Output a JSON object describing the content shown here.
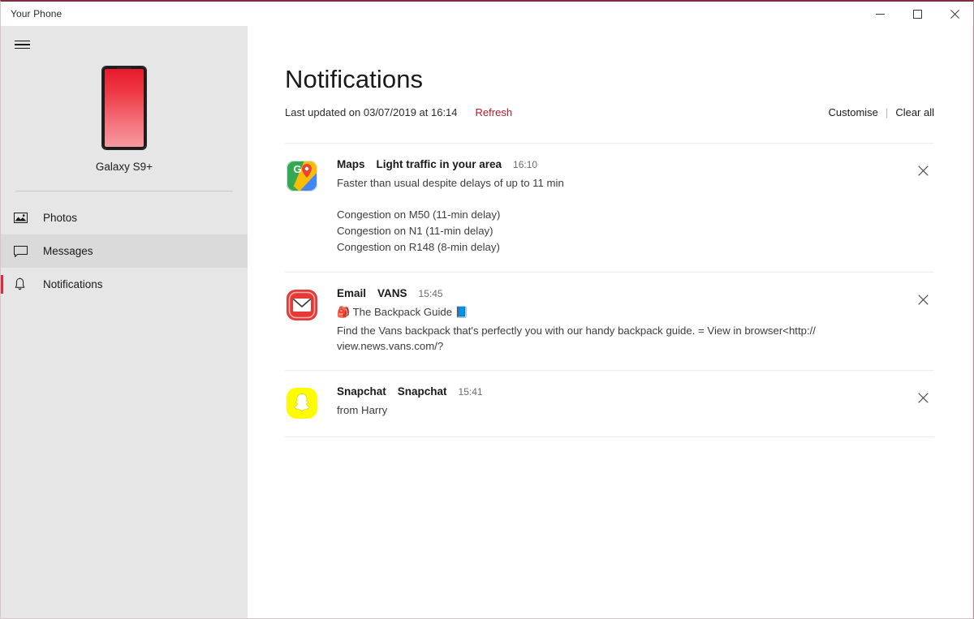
{
  "window": {
    "title": "Your Phone",
    "controls": [
      {
        "name": "minimize",
        "glyph": "minimize-icon"
      },
      {
        "name": "maximize",
        "glyph": "maximize-icon"
      },
      {
        "name": "close",
        "glyph": "close-icon"
      }
    ]
  },
  "sidebar": {
    "menu_icon": "hamburger-icon",
    "device_name": "Galaxy S9+",
    "device_image": "phone-illustration",
    "items": [
      {
        "label": "Photos",
        "icon": "photos-icon",
        "state": "normal"
      },
      {
        "label": "Messages",
        "icon": "messages-icon",
        "state": "hovered"
      },
      {
        "label": "Notifications",
        "icon": "bell-icon",
        "state": "selected"
      }
    ]
  },
  "main": {
    "page_title": "Notifications",
    "last_updated": "Last updated on 03/07/2019 at 16:14",
    "refresh_label": "Refresh",
    "customise_label": "Customise",
    "separator": "|",
    "clear_all_label": "Clear all",
    "close_glyph": "×",
    "notifications": [
      {
        "icon": "google-maps-icon",
        "app": "Maps",
        "title": "Light traffic in your area",
        "time": "16:10",
        "line": "Faster than usual despite delays of up to 11 min",
        "extra": [
          "Congestion on M50 (11-min delay)",
          "Congestion on N1 (11-min delay)",
          "Congestion on R148 (8-min delay)"
        ]
      },
      {
        "icon": "email-icon",
        "app": "Email",
        "title": "VANS",
        "time": "15:45",
        "line_prefix_emoji": "🎒",
        "line": "The Backpack Guide",
        "line_suffix_emoji": "📘",
        "extra": [
          "Find the Vans backpack that's perfectly you with our handy backpack guide. = View in browser<http:// view.news.vans.com/?"
        ]
      },
      {
        "icon": "snapchat-icon",
        "app": "Snapchat",
        "title": "Snapchat",
        "time": "15:41",
        "line": "from Harry",
        "extra": []
      }
    ]
  },
  "colors": {
    "accent_red": "#e2293c",
    "link_red": "#b3192b",
    "sidebar_bg": "#e6e6e6",
    "titlebar_border": "#7a2f3e"
  }
}
